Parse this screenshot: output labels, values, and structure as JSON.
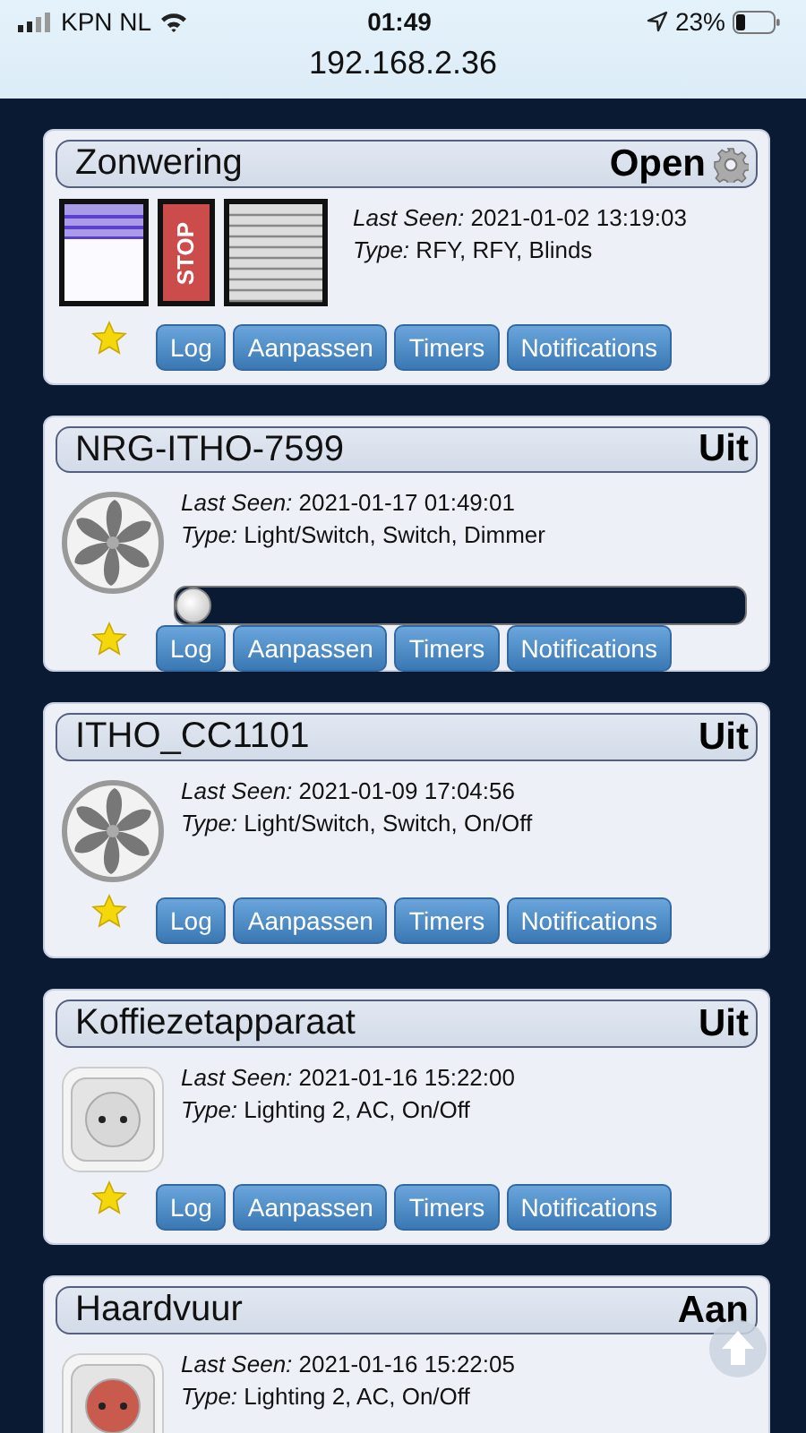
{
  "status_bar": {
    "carrier": "KPN NL",
    "time": "01:49",
    "battery": "23%"
  },
  "address_bar": {
    "url": "192.168.2.36"
  },
  "devices": [
    {
      "kind": "blinds",
      "name": "Zonwering",
      "status": "Open",
      "stop_label": "STOP",
      "last_seen": "*Last Seen:* 2021-01-02 13:19:03",
      "type": "*Type:* RFY, RFY, Blinds",
      "favorite": true,
      "buttons": [
        "Log",
        "Aanpassen",
        "Timers",
        "Notifications"
      ]
    },
    {
      "kind": "dimmer",
      "name": "NRG-ITHO-7599",
      "status": "Uit",
      "last_seen": "*Last Seen:* 2021-01-17 01:49:01",
      "type": "*Type:* Light/Switch, Switch, Dimmer",
      "level": 0,
      "favorite": true,
      "buttons": [
        "Log",
        "Aanpassen",
        "Timers",
        "Notifications"
      ]
    },
    {
      "kind": "fan",
      "name": "ITHO_CC1101",
      "status": "Uit",
      "last_seen": "*Last Seen:* 2021-01-09 17:04:56",
      "type": "*Type:* Light/Switch, Switch, On/Off",
      "favorite": true,
      "buttons": [
        "Log",
        "Aanpassen",
        "Timers",
        "Notifications"
      ]
    },
    {
      "kind": "socket",
      "on": false,
      "name": "Koffiezetapparaat",
      "status": "Uit",
      "last_seen": "*Last Seen:* 2021-01-16 15:22:00",
      "type": "*Type:* Lighting 2, AC, On/Off",
      "favorite": true,
      "buttons": [
        "Log",
        "Aanpassen",
        "Timers",
        "Notifications"
      ]
    },
    {
      "kind": "socket",
      "on": true,
      "name": "Haardvuur",
      "status": "Aan",
      "last_seen": "*Last Seen:* 2021-01-16 15:22:05",
      "type": "*Type:* Lighting 2, AC, On/Off"
    }
  ]
}
